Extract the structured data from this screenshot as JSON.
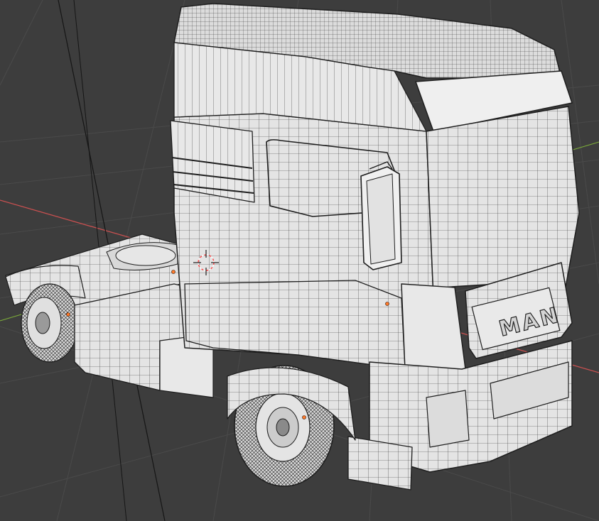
{
  "viewport": {
    "background_color": "#3d3d3d",
    "grid_color": "#4a4a4a",
    "x_axis_color": "#c85050",
    "y_axis_color": "#7aa83a"
  },
  "model": {
    "grille_logo": "MAN",
    "surface_color": "#e6e6e6",
    "wire_color": "#1e1e1e"
  },
  "icons": {
    "origin_marker": "origin-dot-icon",
    "cursor": "3d-cursor-icon"
  }
}
